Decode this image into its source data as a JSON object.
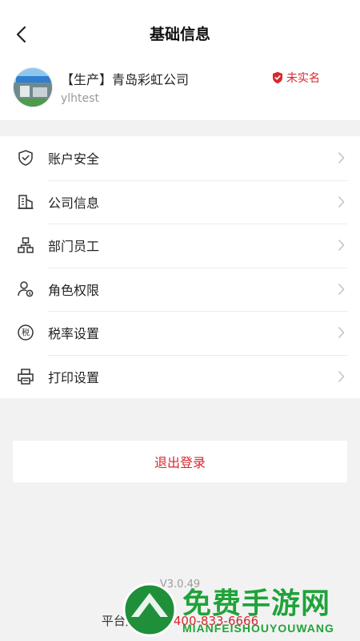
{
  "header": {
    "title": "基础信息"
  },
  "profile": {
    "company_name": "【生产】青岛彩虹公司",
    "account_id": "ylhtest",
    "verify_badge": "未实名"
  },
  "menu": {
    "items": [
      {
        "label": "账户安全",
        "icon": "shield-check-icon"
      },
      {
        "label": "公司信息",
        "icon": "building-icon"
      },
      {
        "label": "部门员工",
        "icon": "org-chart-icon"
      },
      {
        "label": "角色权限",
        "icon": "user-key-icon"
      },
      {
        "label": "税率设置",
        "icon": "tax-icon"
      },
      {
        "label": "打印设置",
        "icon": "printer-icon"
      }
    ]
  },
  "logout": {
    "label": "退出登录"
  },
  "footer": {
    "version": "V3.0.49",
    "service_prefix": "平台运营服务",
    "phone": "400-833-6666"
  },
  "watermark": {
    "text": "免费手游网",
    "subtext": "MIANFEISHOUYOUWANG"
  },
  "colors": {
    "accent": "#d7282f",
    "watermark": "#20a33a"
  }
}
